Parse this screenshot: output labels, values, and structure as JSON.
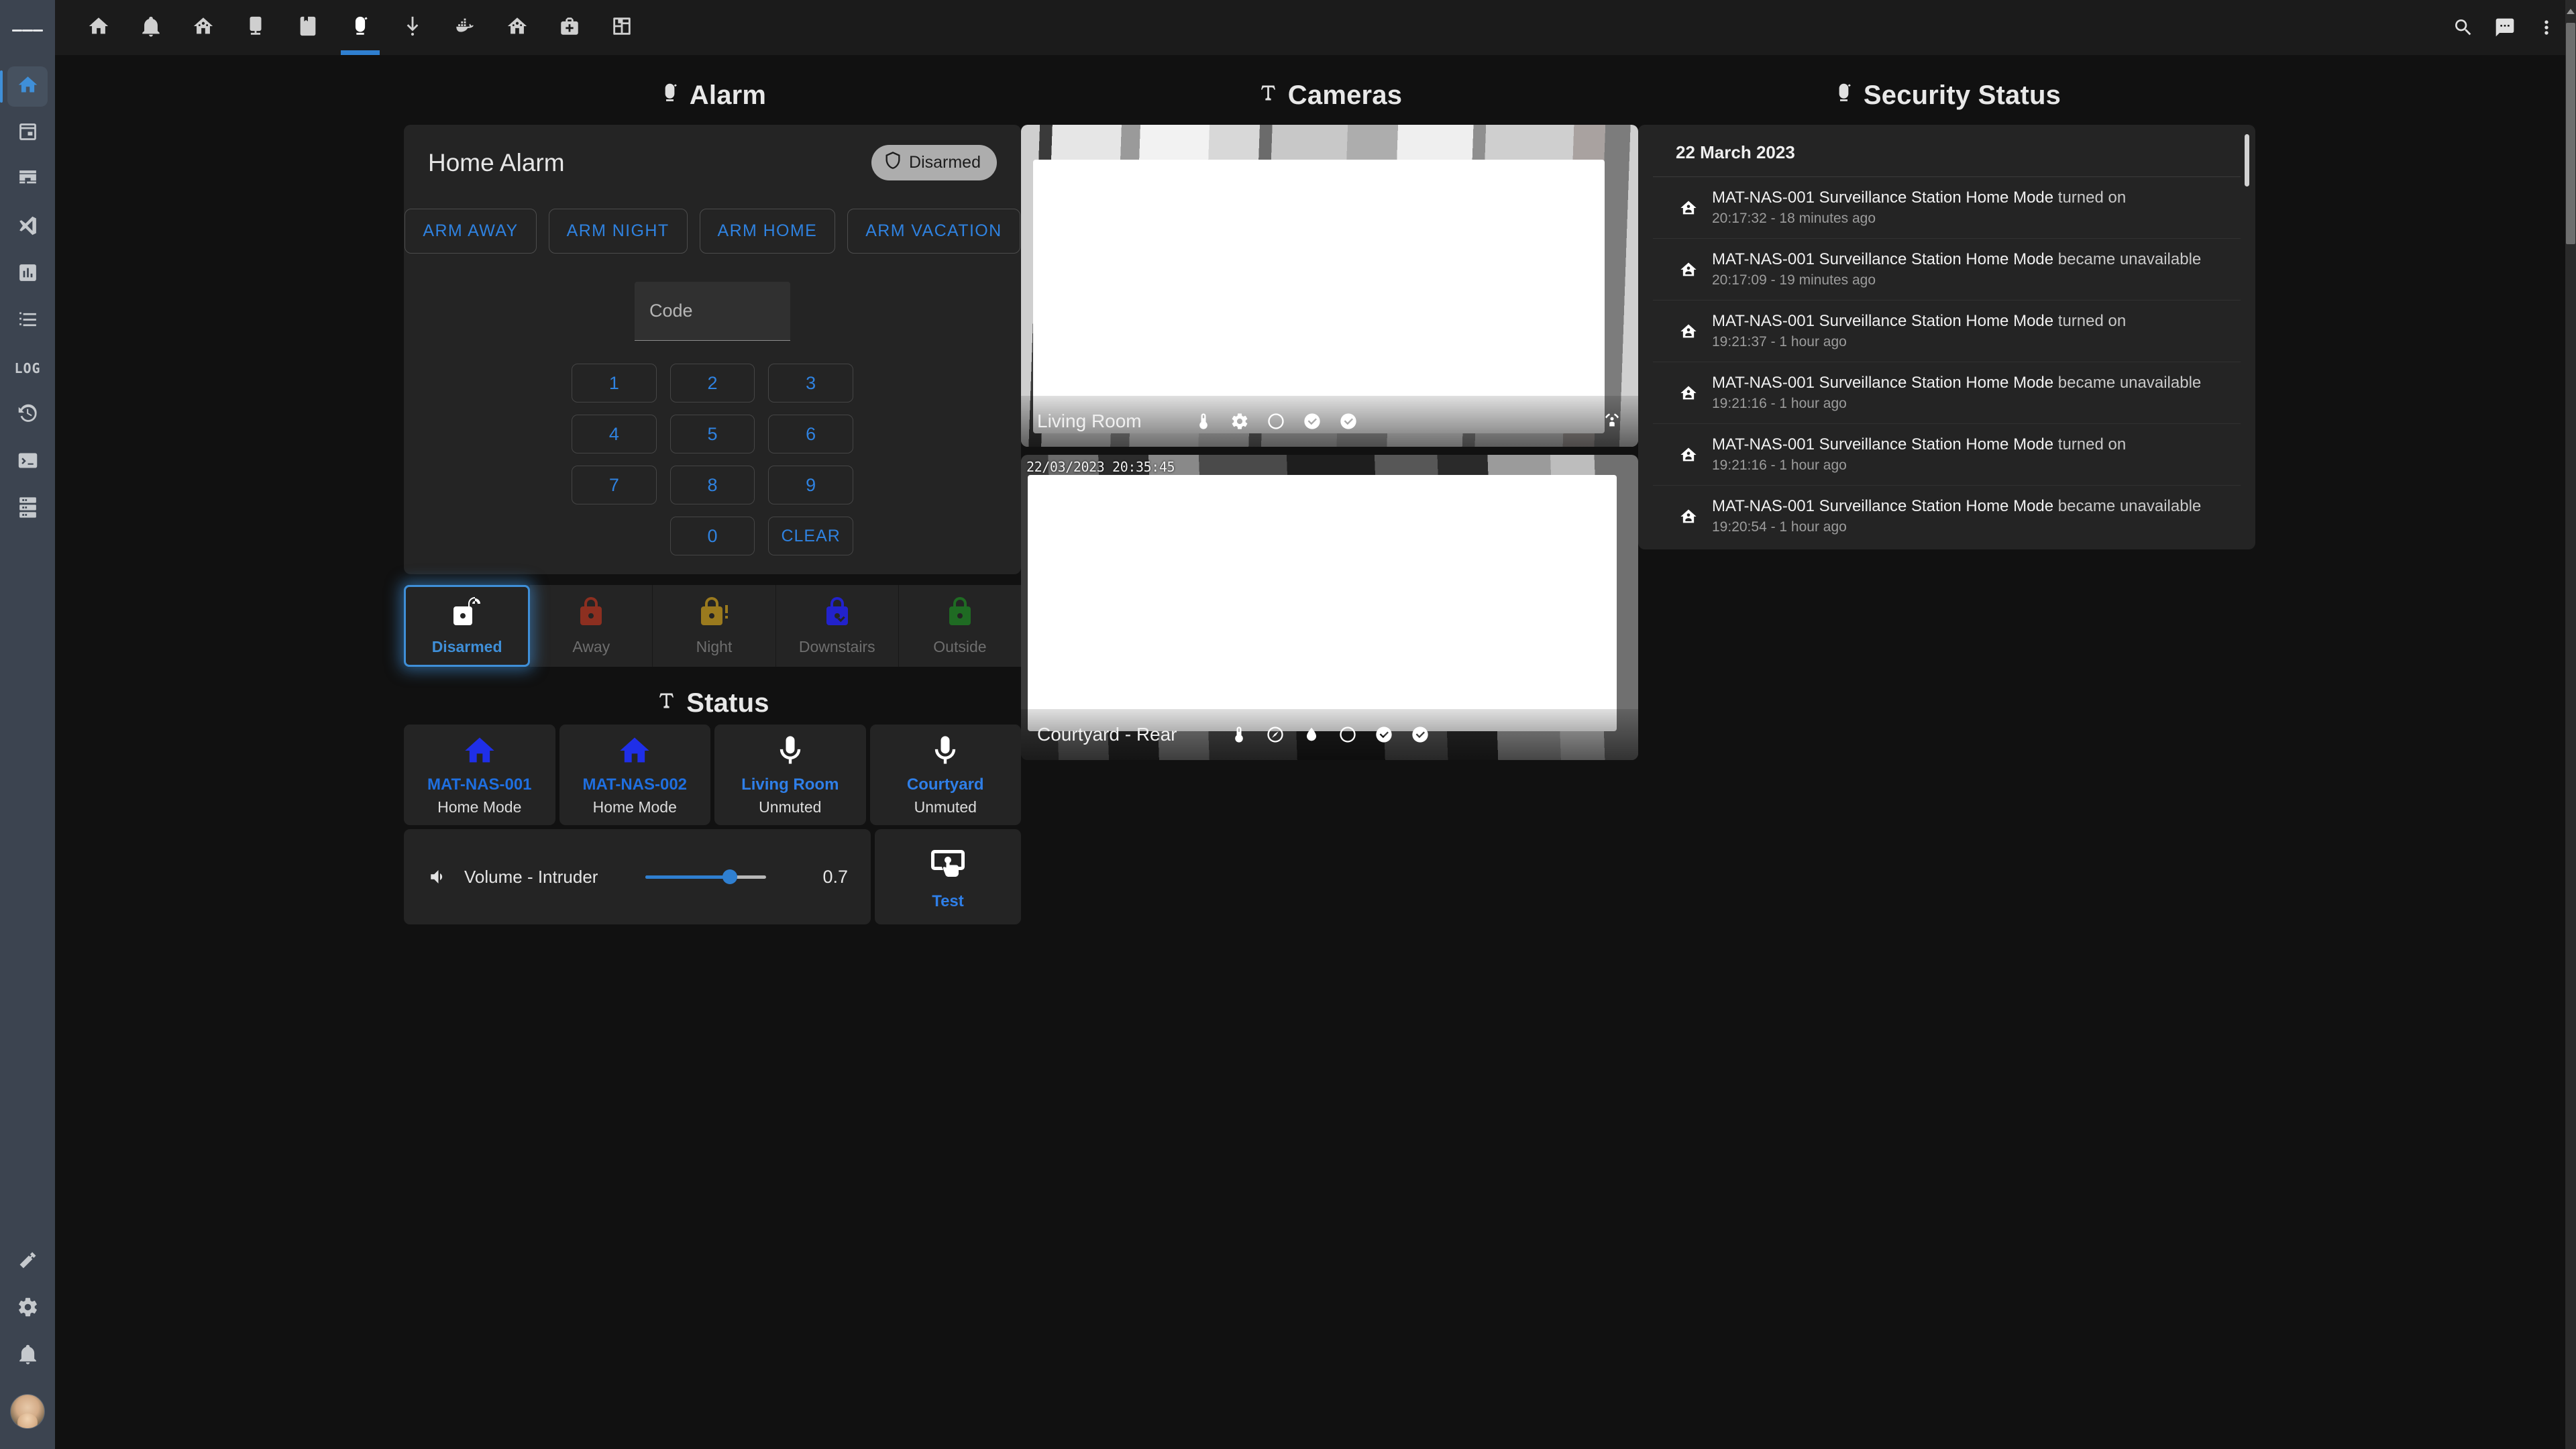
{
  "sidebar": {
    "menu_icon": "hamburger-icon",
    "items": [
      {
        "icon": "home-icon",
        "name": "overview",
        "active": true
      },
      {
        "icon": "calendar-icon",
        "name": "calendar",
        "active": false
      },
      {
        "icon": "hacs-icon",
        "name": "hacs",
        "active": false,
        "label": "HACS"
      },
      {
        "icon": "vscode-icon",
        "name": "vscode",
        "active": false
      },
      {
        "icon": "chart-box-icon",
        "name": "statistics",
        "active": false
      },
      {
        "icon": "list-icon",
        "name": "todo-list",
        "active": false
      },
      {
        "icon": "log-text-icon",
        "name": "log",
        "active": false,
        "label": "LOG"
      },
      {
        "icon": "history-icon",
        "name": "history",
        "active": false
      },
      {
        "icon": "terminal-icon",
        "name": "terminal",
        "active": false
      },
      {
        "icon": "server-icon",
        "name": "server",
        "active": false
      }
    ],
    "bottom_items": [
      {
        "icon": "hammer-icon",
        "name": "developer-tools"
      },
      {
        "icon": "gear-icon",
        "name": "settings"
      },
      {
        "icon": "bell-icon",
        "name": "notifications"
      }
    ],
    "avatar": "user-avatar"
  },
  "topbar": {
    "tabs": [
      {
        "icon": "home-icon",
        "name": "tab-home",
        "active": false
      },
      {
        "icon": "bell-icon",
        "name": "tab-alerts",
        "active": false
      },
      {
        "icon": "home-automation-icon",
        "name": "tab-automation",
        "active": false
      },
      {
        "icon": "tablet-dashboard-icon",
        "name": "tab-tablet",
        "active": false
      },
      {
        "icon": "notebook-icon",
        "name": "tab-notes",
        "active": false
      },
      {
        "icon": "alarm-light-icon",
        "name": "tab-security",
        "active": true
      },
      {
        "icon": "download-icon",
        "name": "tab-downloads",
        "active": false
      },
      {
        "icon": "docker-icon",
        "name": "tab-docker",
        "active": false
      },
      {
        "icon": "home-automation-icon",
        "name": "tab-home-automation-2",
        "active": false
      },
      {
        "icon": "medical-bag-icon",
        "name": "tab-medical",
        "active": false
      },
      {
        "icon": "floorplan-icon",
        "name": "tab-floorplan",
        "active": false
      }
    ],
    "actions": [
      {
        "icon": "search-icon",
        "name": "search"
      },
      {
        "icon": "assist-chat-icon",
        "name": "assist"
      },
      {
        "icon": "overflow-menu-icon",
        "name": "more-options"
      }
    ]
  },
  "alarm": {
    "section_title": "Alarm",
    "section_icon": "alarm-light-icon",
    "card_title": "Home Alarm",
    "badge": {
      "label": "Disarmed",
      "icon": "shield-off-icon"
    },
    "arm_buttons": [
      {
        "label": "ARM AWAY",
        "name": "arm-away-button"
      },
      {
        "label": "ARM NIGHT",
        "name": "arm-night-button"
      },
      {
        "label": "ARM HOME",
        "name": "arm-home-button"
      },
      {
        "label": "ARM VACATION",
        "name": "arm-vacation-button"
      }
    ],
    "code_field": {
      "placeholder": "Code",
      "value": ""
    },
    "keypad": [
      "1",
      "2",
      "3",
      "4",
      "5",
      "6",
      "7",
      "8",
      "9",
      "",
      "0",
      "CLEAR"
    ],
    "modes": [
      {
        "label": "Disarmed",
        "icon": "lock-open-icon",
        "color": "#ffffff",
        "selected": true
      },
      {
        "label": "Away",
        "icon": "lock-icon",
        "color": "#8c2f20",
        "selected": false
      },
      {
        "label": "Night",
        "icon": "lock-alert-icon",
        "color": "#9a7a1e",
        "selected": false
      },
      {
        "label": "Downstairs",
        "icon": "lock-check-icon",
        "color": "#2222cc",
        "selected": false
      },
      {
        "label": "Outside",
        "icon": "lock-minus-icon",
        "color": "#1f6b23",
        "selected": false
      }
    ]
  },
  "status": {
    "section_title": "Status",
    "section_icon": "cctv-icon",
    "tiles": [
      {
        "name": "MAT-NAS-001",
        "state": "Home Mode",
        "icon": "home-icon",
        "color": "#1f2fe8"
      },
      {
        "name": "MAT-NAS-002",
        "state": "Home Mode",
        "icon": "home-icon",
        "color": "#1f2fe8"
      },
      {
        "name": "Living Room",
        "state": "Unmuted",
        "icon": "microphone-icon",
        "color": "#ffffff"
      },
      {
        "name": "Courtyard",
        "state": "Unmuted",
        "icon": "microphone-icon",
        "color": "#ffffff"
      }
    ],
    "volume": {
      "icon": "volume-medium-icon",
      "label": "Volume - Intruder",
      "value": "0.7",
      "percent": 70
    },
    "test": {
      "label": "Test",
      "icon": "gesture-tap-button-icon"
    }
  },
  "cameras": {
    "section_title": "Cameras",
    "section_icon": "cctv-icon",
    "items": [
      {
        "name": "Living Room",
        "timestamp": "",
        "icons": [
          "thermometer-icon",
          "gear-icon",
          "circle-outline-icon",
          "check-circle-icon",
          "check-circle-icon"
        ],
        "right_icon": "motion-sensor-icon"
      },
      {
        "name": "Courtyard - Rear",
        "timestamp": "22/03/2023  20:35:45",
        "icons": [
          "thermometer-icon",
          "gauge-icon",
          "water-icon",
          "circle-outline-icon",
          "check-circle-icon",
          "check-circle-icon"
        ],
        "right_icon": ""
      }
    ]
  },
  "security_status": {
    "section_title": "Security Status",
    "section_icon": "alarm-light-icon",
    "date": "22 March 2023",
    "entries": [
      {
        "icon": "home-icon",
        "entity": "MAT-NAS-001 Surveillance Station Home Mode",
        "event": "turned on",
        "time": "20:17:32 - 18 minutes ago"
      },
      {
        "icon": "home-icon",
        "entity": "MAT-NAS-001 Surveillance Station Home Mode",
        "event": "became unavailable",
        "time": "20:17:09 - 19 minutes ago"
      },
      {
        "icon": "home-icon",
        "entity": "MAT-NAS-001 Surveillance Station Home Mode",
        "event": "turned on",
        "time": "19:21:37 - 1 hour ago"
      },
      {
        "icon": "home-icon",
        "entity": "MAT-NAS-001 Surveillance Station Home Mode",
        "event": "became unavailable",
        "time": "19:21:16 - 1 hour ago"
      },
      {
        "icon": "home-icon",
        "entity": "MAT-NAS-001 Surveillance Station Home Mode",
        "event": "turned on",
        "time": "19:21:16 - 1 hour ago"
      },
      {
        "icon": "home-icon",
        "entity": "MAT-NAS-001 Surveillance Station Home Mode",
        "event": "became unavailable",
        "time": "19:20:54 - 1 hour ago"
      }
    ]
  },
  "colors": {
    "accent": "#2f7fd0",
    "background": "#111111",
    "card": "#242424",
    "sidebar": "#3c4450"
  }
}
